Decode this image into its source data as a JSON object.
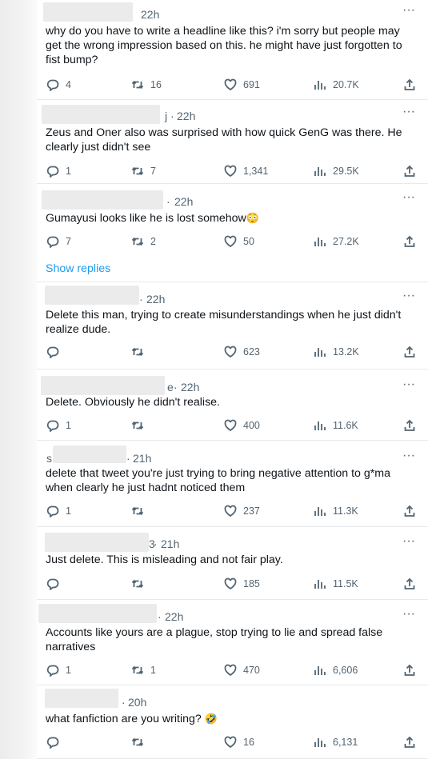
{
  "replies": [
    {
      "time": "22h",
      "text": "why do you have to write a headline like this? i'm sorry but people may get the wrong impression based on this. he might have just forgotten to fist bump?",
      "reply_count": "4",
      "retweet_count": "16",
      "like_count": "691",
      "view_count": "20.7K",
      "name_prefix": ""
    },
    {
      "time": "22h",
      "text": "Zeus and Oner also was surprised with how quick GenG was there. He clearly just didn't see",
      "reply_count": "1",
      "retweet_count": "7",
      "like_count": "1,341",
      "view_count": "29.5K",
      "name_prefix": "j"
    },
    {
      "time": "22h",
      "text": "Gumayusi looks like he is lost somehow",
      "emoji": "😳",
      "reply_count": "7",
      "retweet_count": "2",
      "like_count": "50",
      "view_count": "27.2K",
      "name_prefix": ""
    },
    {
      "time": "22h",
      "text": "Delete this man, trying to create misunderstandings when he just didn't realize dude.",
      "reply_count": "",
      "retweet_count": "",
      "like_count": "623",
      "view_count": "13.2K",
      "name_prefix": ""
    },
    {
      "time": "22h",
      "text": "Delete. Obviously he didn't realise.",
      "reply_count": "1",
      "retweet_count": "",
      "like_count": "400",
      "view_count": "11.6K",
      "name_prefix": "e"
    },
    {
      "time": "21h",
      "text": "delete that tweet you're just trying to bring negative attention to g*ma when clearly he just hadnt noticed them",
      "reply_count": "1",
      "retweet_count": "",
      "like_count": "237",
      "view_count": "11.3K",
      "name_prefix": "s"
    },
    {
      "time": "21h",
      "text": "Just delete. This is misleading and not fair play.",
      "reply_count": "",
      "retweet_count": "",
      "like_count": "185",
      "view_count": "11.5K",
      "name_prefix": "3"
    },
    {
      "time": "22h",
      "text": "Accounts like yours are a plague, stop trying to lie and spread false narratives",
      "reply_count": "1",
      "retweet_count": "1",
      "like_count": "470",
      "view_count": "6,606",
      "name_prefix": ""
    },
    {
      "time": "20h",
      "text": "what fanfiction are you writing?",
      "emoji": "🤣",
      "reply_count": "",
      "retweet_count": "",
      "like_count": "16",
      "view_count": "6,131",
      "name_prefix": ""
    }
  ],
  "show_replies_label": "Show replies",
  "more_label": "···",
  "icons": {
    "reply": "reply-icon",
    "retweet": "retweet-icon",
    "like": "heart-icon",
    "views": "views-icon",
    "share": "share-icon",
    "more": "more-icon"
  },
  "colors": {
    "text": "#0f1419",
    "muted": "#536471",
    "link": "#1d9bf0",
    "divider": "#e7e9ea"
  }
}
